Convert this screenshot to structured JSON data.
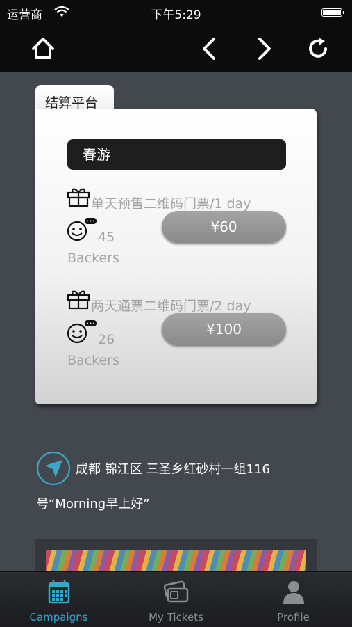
{
  "status_bar": {
    "carrier": "运营商",
    "time": "下午5:29"
  },
  "nav": {
    "home_icon": "home-icon",
    "back_icon": "chevron-left-icon",
    "forward_icon": "chevron-right-icon",
    "refresh_icon": "refresh-icon"
  },
  "card": {
    "tab_label": "结算平台",
    "event_title": "春游",
    "rewards": [
      {
        "name": "单天预售二维码门票/1 day",
        "backers_count": "45",
        "backers_label": "Backers",
        "price": "¥60"
      },
      {
        "name": "两天通票二维码门票/2 day",
        "backers_count": "26",
        "backers_label": "Backers",
        "price": "¥100"
      }
    ]
  },
  "location": {
    "line1": "成都 锦江区 三圣乡红砂村一组116",
    "line2": "号“Morning早上好”"
  },
  "tabbar": {
    "tabs": [
      {
        "label": "Campaigns",
        "icon": "calendar-icon",
        "active": true
      },
      {
        "label": "My Tickets",
        "icon": "tickets-icon",
        "active": false
      },
      {
        "label": "Profile",
        "icon": "profile-icon",
        "active": false
      }
    ]
  },
  "colors": {
    "accent": "#3aa7c9",
    "background": "#43474e",
    "bar": "#0c0c0d"
  }
}
